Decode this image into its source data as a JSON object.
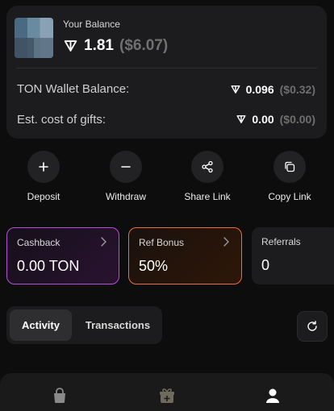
{
  "balance": {
    "label": "Your Balance",
    "amount": "1.81",
    "usd": "($6.07)"
  },
  "wallet": {
    "label": "TON Wallet Balance:",
    "amount": "0.096",
    "usd": "($0.32)"
  },
  "gifts": {
    "label": "Est. cost of gifts:",
    "amount": "0.00",
    "usd": "($0.00)"
  },
  "actions": [
    {
      "label": "Deposit",
      "icon": "plus-icon"
    },
    {
      "label": "Withdraw",
      "icon": "minus-icon"
    },
    {
      "label": "Share Link",
      "icon": "share-icon"
    },
    {
      "label": "Copy Link",
      "icon": "copy-icon"
    }
  ],
  "stats": {
    "cashback": {
      "title": "Cashback",
      "value": "0.00 TON",
      "border_color": "#b84ed8"
    },
    "ref_bonus": {
      "title": "Ref Bonus",
      "value": "50%",
      "border_color": "#e8703a"
    },
    "referrals": {
      "title": "Referrals",
      "value": "0"
    }
  },
  "tabs": [
    {
      "label": "Activity",
      "active": true
    },
    {
      "label": "Transactions",
      "active": false
    }
  ],
  "nav": [
    "bag-icon",
    "gift-icon",
    "profile-icon"
  ],
  "colors": {
    "background": "#0d0d0d",
    "card": "#1c1c1e",
    "muted": "#6e6e6e"
  }
}
